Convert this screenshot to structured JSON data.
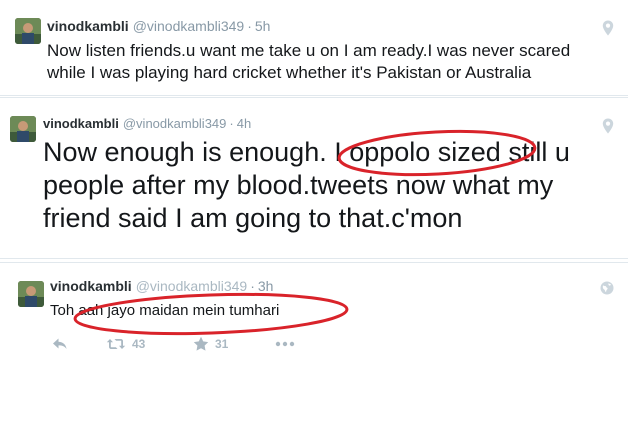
{
  "tweets": [
    {
      "display_name": "vinodkambli",
      "handle": "@vinodkambli349",
      "separator": "·",
      "time": "5h",
      "text": "Now listen friends.u want me take u on  I am ready.I was never scared while I was playing hard cricket whether it's Pakistan or Australia",
      "location_icon": "location-pin-icon"
    },
    {
      "display_name": "vinodkambli",
      "handle": "@vinodkambli349",
      "separator": "·",
      "time": "4h",
      "text": "Now enough is enough. I oppolo sized still u people after my blood.tweets now what my friend said I am going to that.c'mon",
      "location_icon": "location-pin-icon"
    },
    {
      "display_name": "vinodkambli",
      "handle": "@vinodkambli349",
      "separator": "·",
      "time": "3h",
      "text": "Toh aah jayo maidan mein tumhari",
      "globe_icon": "globe-icon",
      "actions": {
        "reply_icon": "reply-icon",
        "retweet_icon": "retweet-icon",
        "retweet_count": "43",
        "like_icon": "star-icon",
        "like_count": "31",
        "more_icon": "more-dots-icon"
      }
    }
  ],
  "annotations": {
    "color": "#d9232a",
    "highlighted_phrases": [
      "I oppolo sized",
      "aah jayo maidan mein tumhari"
    ]
  },
  "colors": {
    "text": "#14171a",
    "secondary": "#8899a6",
    "icon": "#aab8c2",
    "divider": "#e1e8ed",
    "annotation": "#d9232a"
  }
}
